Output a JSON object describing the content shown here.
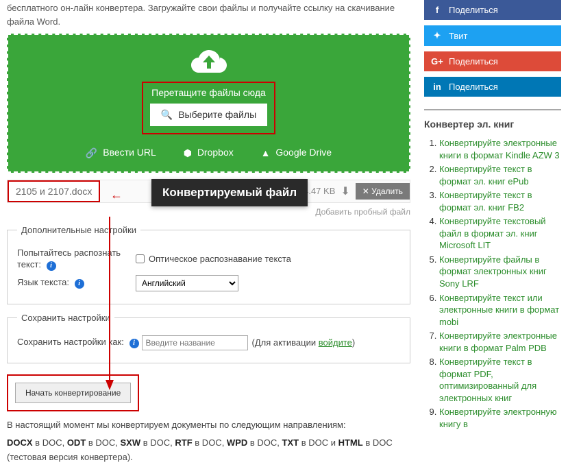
{
  "intro": "бесплатного он-лайн конвертера. Загружайте свои файлы и получайте ссылку на скачивание файла Word.",
  "dropzone": {
    "drag_text": "Перетащите файлы сюда",
    "choose_label": "Выберите файлы",
    "url_label": "Ввести URL",
    "dropbox_label": "Dropbox",
    "gdrive_label": "Google Drive"
  },
  "file": {
    "name": "2105 и 2107.docx",
    "size": "24.47 KB",
    "delete_label": "Удалить",
    "tooltip": "Конвертируемый файл"
  },
  "add_trial": "Добавить пробный файл",
  "fieldset_extra": {
    "legend": "Дополнительные настройки",
    "ocr_intro": "Попытайтесь распознать текст:",
    "ocr_checkbox_label": "Оптическое распознавание текста",
    "lang_label": "Язык текста:",
    "lang_value": "Английский"
  },
  "fieldset_save": {
    "legend": "Сохранить настройки",
    "save_as_label": "Сохранить настройки как:",
    "placeholder": "Введите название",
    "note_prefix": "(Для активации ",
    "login_link": "войдите",
    "note_suffix": ")"
  },
  "convert_button": "Начать конвертирование",
  "formats_intro": "В настоящий момент мы конвертируем документы по следующим направлениям:",
  "formats_list_html": "DOCX в DOC, ODT в DOC, SXW в DOC, RTF в DOC, WPD в DOC, TXT в DOC и HTML в DOC (тестовая версия конвертера).",
  "share": {
    "fb": "Поделиться",
    "tw": "Твит",
    "gp": "Поделиться",
    "ln": "Поделиться"
  },
  "side_heading": "Конвертер эл. книг",
  "ebooks": [
    "Конвертируйте электронные книги в формат Kindle AZW 3",
    "Конвертируйте текст в формат эл. книг ePub",
    "Конвертируйте текст в формат эл. книг FB2",
    "Конвертируйте текстовый файл в формат эл. книг Microsoft LIT",
    "Конвертируйте файлы в формат электронных книг Sony LRF",
    "Конвертируйте текст или электронные книги в формат mobi",
    "Конвертируйте электронные книги в формат Palm PDB",
    "Конвертируйте текст в формат PDF, оптимизированный для электронных книг",
    "Конвертируйте электронную книгу в"
  ]
}
